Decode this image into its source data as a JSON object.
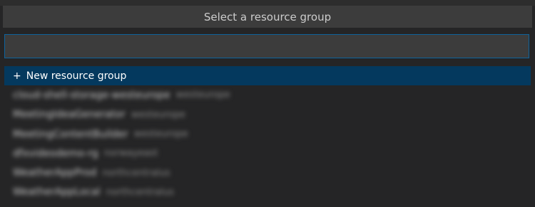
{
  "quick_pick": {
    "title": "Select a resource group",
    "input": {
      "value": "",
      "placeholder": ""
    },
    "items": [
      {
        "label": "New resource group",
        "description": "",
        "icon": "plus-icon"
      },
      {
        "label": "cloud-shell-storage-westeurope",
        "description": "westeurope"
      },
      {
        "label": "MeetingIdeaGenerator",
        "description": "westeurope"
      },
      {
        "label": "MeetingContentBuilder",
        "description": "westeurope"
      },
      {
        "label": "dfxvideodemo-rg",
        "description": "norwayeast"
      },
      {
        "label": "WeatherAppProd",
        "description": "northcentralus"
      },
      {
        "label": "WeatherAppLocal",
        "description": "northcentralus"
      }
    ]
  },
  "colors": {
    "selected_bg": "#04395e",
    "focus_border": "#0e639c",
    "panel_bg": "#252526"
  }
}
